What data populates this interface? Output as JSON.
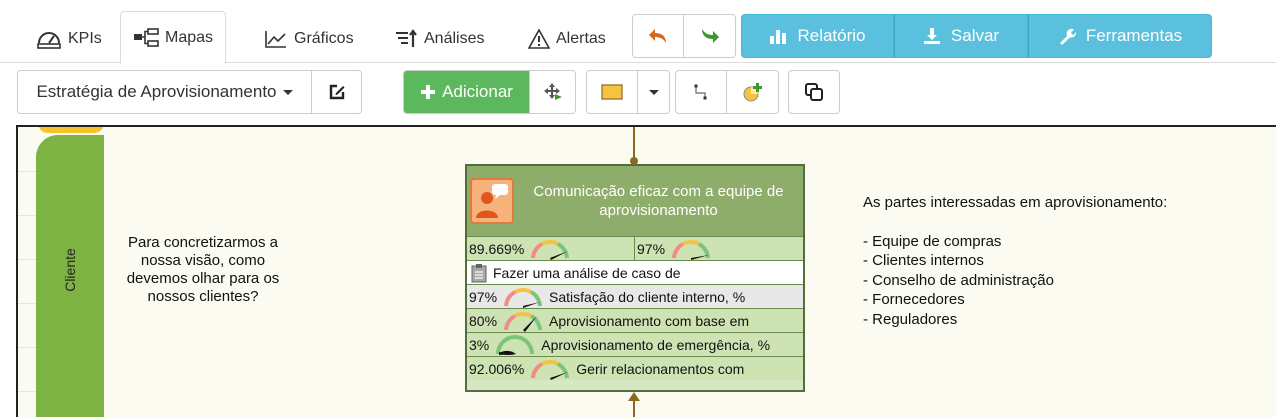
{
  "tabs": [
    {
      "label": "KPIs",
      "icon": "dashboard-icon"
    },
    {
      "label": "Mapas",
      "icon": "hierarchy-icon",
      "active": true
    },
    {
      "label": "Gráficos",
      "icon": "line-chart-icon"
    },
    {
      "label": "Análises",
      "icon": "sort-analysis-icon"
    },
    {
      "label": "Alertas",
      "icon": "warning-icon"
    }
  ],
  "actions": {
    "report_label": "Relatório",
    "save_label": "Salvar",
    "tools_label": "Ferramentas"
  },
  "toolbar": {
    "map_selector": "Estratégia de Aprovisionamento",
    "add_label": "Adicionar"
  },
  "lane": {
    "label": "Cliente"
  },
  "question": "Para concretizarmos a nossa visão, como devemos olhar para os nossos clientes?",
  "objective": {
    "title": "Comunicação eficaz com a equipe de aprovisionamento",
    "kpi_pair": [
      {
        "value": "89.669%"
      },
      {
        "value": "97%"
      }
    ],
    "initiative": "Fazer uma análise de caso de",
    "kpis": [
      {
        "value": "97%",
        "name": "Satisfação do cliente interno, %"
      },
      {
        "value": "80%",
        "name": "Aprovisionamento com base em"
      },
      {
        "value": "3%",
        "name": "Aprovisionamento de emergência, %"
      },
      {
        "value": "92.006%",
        "name": "Gerir relacionamentos com"
      }
    ]
  },
  "stakeholders": {
    "heading": "As partes interessadas em aprovisionamento:",
    "items": [
      "- Equipe de compras",
      "- Clientes internos",
      "- Conselho de administração",
      "- Fornecedores",
      "- Reguladores"
    ]
  },
  "colors": {
    "accent_blue": "#5bc0de",
    "accent_green": "#5cb85c",
    "lane_green": "#7cb342",
    "card_header": "#8fad6a"
  }
}
